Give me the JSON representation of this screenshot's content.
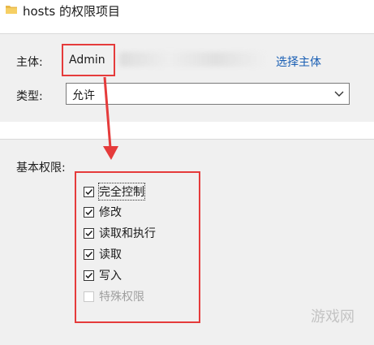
{
  "window": {
    "title": "hosts 的权限项目",
    "icon": "folder-icon"
  },
  "principal": {
    "label": "主体:",
    "value": "Admin",
    "select_link": "选择主体"
  },
  "type": {
    "label": "类型:",
    "selected": "允许"
  },
  "basic_permissions": {
    "label": "基本权限:",
    "items": [
      {
        "label": "完全控制",
        "checked": true,
        "enabled": true
      },
      {
        "label": "修改",
        "checked": true,
        "enabled": true
      },
      {
        "label": "读取和执行",
        "checked": true,
        "enabled": true
      },
      {
        "label": "读取",
        "checked": true,
        "enabled": true
      },
      {
        "label": "写入",
        "checked": true,
        "enabled": true
      },
      {
        "label": "特殊权限",
        "checked": false,
        "enabled": false
      }
    ]
  },
  "annotation_color": "#e53b3b",
  "watermark": "游戏网"
}
